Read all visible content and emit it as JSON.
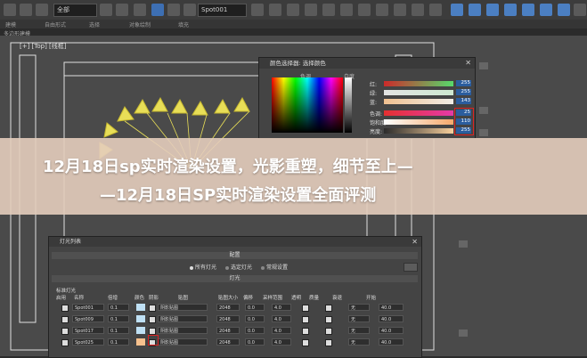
{
  "toolbar": {
    "selection_filter": "全部",
    "scene_combo": "Spot001",
    "ribbon_tabs": [
      "建模",
      "自由形式",
      "选择",
      "对象绘制",
      "填充"
    ],
    "subtab": "多边形建模",
    "viewport_label": "[+] [Top] [线框]"
  },
  "color_picker": {
    "title": "颜色选择器: 选择颜色",
    "hue_label": "色调",
    "whiteness_label": "白度",
    "sliders": [
      {
        "label": "红:",
        "value": "255",
        "gradient": [
          "#cc2a2a",
          "#57d96b"
        ]
      },
      {
        "label": "绿:",
        "value": "255",
        "gradient": [
          "#e3e3e3",
          "#cde8d0"
        ]
      },
      {
        "label": "蓝:",
        "value": "143",
        "gradient": [
          "#f0c090",
          "#f1ede6"
        ]
      },
      {
        "label": "色调:",
        "value": "25",
        "gradient": [
          "#e53030",
          "#e53aa8"
        ]
      },
      {
        "label": "饱和度:",
        "value": "110",
        "gradient": [
          "#ffffff",
          "#f6a96b"
        ]
      },
      {
        "label": "亮度:",
        "value": "255",
        "gradient": [
          "#2b2b2b",
          "#f7cf9c"
        ]
      }
    ]
  },
  "banner": {
    "line1": "12月18日sp实时渲染设置，光影重塑，细节至上—",
    "line2": "—12月18日SP实时渲染设置全面评测"
  },
  "light_lister": {
    "title": "灯光列表",
    "config_section": "配置",
    "radio_all": "所有灯光",
    "radio_selected": "选定灯光",
    "radio_general": "常规设置",
    "lights_section": "灯光",
    "group_label": "标准灯光",
    "columns": [
      "启用",
      "名称",
      "倍增",
      "颜色",
      "阴影",
      "贴图",
      "贴图大小",
      "偏移",
      "采样范围",
      "透明",
      "质量",
      "衰退",
      "开始"
    ],
    "rows": [
      {
        "name": "Spot001",
        "multiplier": "0.1",
        "color": "#bfe0f4",
        "shadow": "阴影贴图",
        "map_size": "2048",
        "bias": "0.0",
        "range": "4.0",
        "decay": "无",
        "start": "40.0"
      },
      {
        "name": "Spot009",
        "multiplier": "0.1",
        "color": "#bfe0f4",
        "shadow": "阴影贴图",
        "map_size": "2048",
        "bias": "0.0",
        "range": "4.0",
        "decay": "无",
        "start": "40.0"
      },
      {
        "name": "Spot017",
        "multiplier": "0.1",
        "color": "#bfe0f4",
        "shadow": "阴影贴图",
        "map_size": "2048",
        "bias": "0.0",
        "range": "4.0",
        "decay": "无",
        "start": "40.0"
      },
      {
        "name": "Spot025",
        "multiplier": "0.1",
        "color": "#f6c08d",
        "shadow": "阴影贴图",
        "map_size": "2048",
        "bias": "0.0",
        "range": "4.0",
        "decay": "无",
        "start": "40.0"
      }
    ]
  }
}
